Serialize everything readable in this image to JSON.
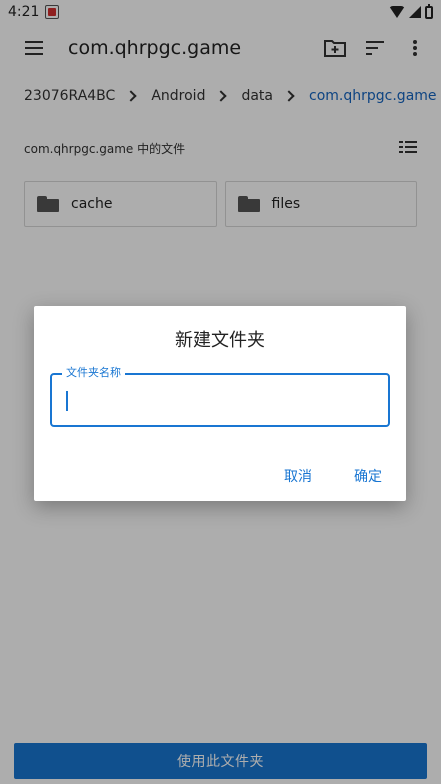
{
  "status_bar": {
    "time": "4:21",
    "app_icon": "notification-app-icon",
    "icons": [
      "wifi-icon",
      "cell-signal-icon",
      "battery-icon"
    ]
  },
  "app_bar": {
    "title": "com.qhrpgc.game",
    "icons": [
      "menu-icon",
      "new-folder-icon",
      "sort-icon",
      "more-vert-icon"
    ]
  },
  "breadcrumb": [
    "23076RA4BC",
    "Android",
    "data",
    "com.qhrpgc.game"
  ],
  "section": {
    "title": "com.qhrpgc.game 中的文件",
    "view_icon": "list-view-icon"
  },
  "folders": [
    {
      "name": "cache",
      "icon": "folder-icon"
    },
    {
      "name": "files",
      "icon": "folder-icon"
    }
  ],
  "bottom_button": {
    "label": "使用此文件夹"
  },
  "dialog": {
    "title": "新建文件夹",
    "field_label": "文件夹名称",
    "field_value": "",
    "cancel_label": "取消",
    "confirm_label": "确定"
  },
  "colors": {
    "accent": "#1976d2",
    "breadcrumb_active": "#1565c0",
    "scrim": "rgba(0,0,0,0.32)"
  }
}
